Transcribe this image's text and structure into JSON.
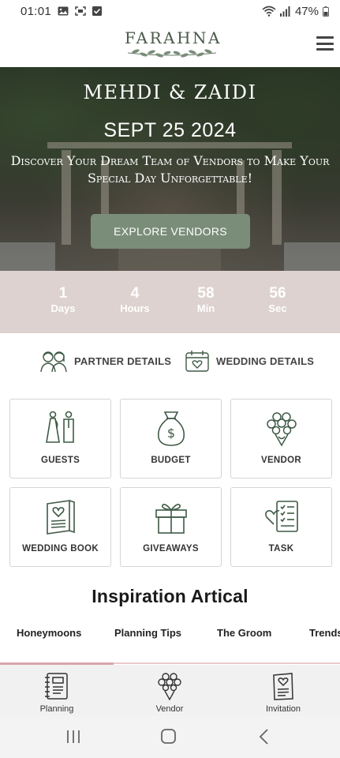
{
  "status_bar": {
    "time": "01:01",
    "battery": "47%",
    "icons": [
      "image-icon",
      "screenshot-icon",
      "check-square-icon",
      "wifi-icon",
      "signal-icon",
      "battery-icon"
    ]
  },
  "header": {
    "logo_text": "FARAHNA",
    "menu_icon": "hamburger-menu-icon"
  },
  "hero": {
    "names": "MEHDI & ZAIDI",
    "date": "SEPT 25 2024",
    "tagline": "Discover Your Dream Team of Vendors to Make Your Special Day Unforgettable!",
    "button_label": "EXPLORE VENDORS"
  },
  "countdown": {
    "items": [
      {
        "value": "1",
        "label": "Days"
      },
      {
        "value": "4",
        "label": "Hours"
      },
      {
        "value": "58",
        "label": "Min"
      },
      {
        "value": "56",
        "label": "Sec"
      }
    ]
  },
  "details": {
    "partner_label": "PARTNER DETAILS",
    "wedding_label": "WEDDING DETAILS"
  },
  "grid": {
    "items": [
      {
        "label": "GUESTS",
        "icon": "guests-icon"
      },
      {
        "label": "BUDGET",
        "icon": "money-bag-icon"
      },
      {
        "label": "VENDOR",
        "icon": "bouquet-icon"
      },
      {
        "label": "WEDDING BOOK",
        "icon": "wedding-book-icon"
      },
      {
        "label": "GIVEAWAYS",
        "icon": "gift-icon"
      },
      {
        "label": "TASK",
        "icon": "task-checklist-icon"
      }
    ]
  },
  "inspiration": {
    "title": "Inspiration Artical",
    "tabs": [
      "Honeymoons",
      "Planning Tips",
      "The Groom",
      "Trends"
    ]
  },
  "bottom_nav": {
    "items": [
      {
        "label": "Planning",
        "icon": "planner-notebook-icon"
      },
      {
        "label": "Vendor",
        "icon": "bouquet-icon"
      },
      {
        "label": "Invitation",
        "icon": "invitation-card-icon"
      }
    ]
  },
  "colors": {
    "accent_green": "#7a8d79",
    "countdown_bg": "#ddd2cf",
    "tab_underline": "#d9a5ab",
    "icon_green": "#3f5a45"
  }
}
